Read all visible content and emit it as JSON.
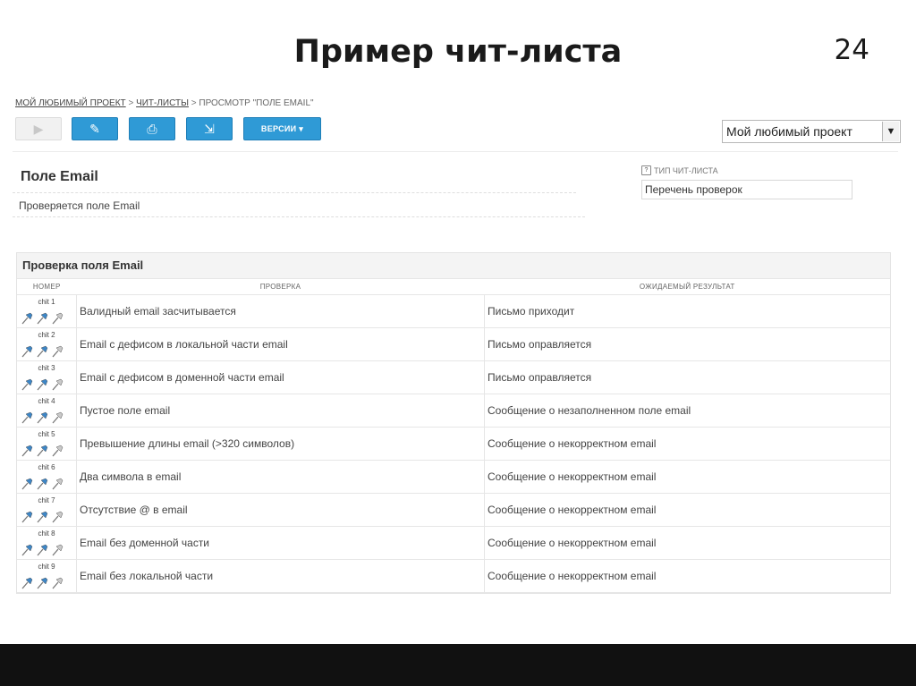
{
  "slide": {
    "title": "Пример чит-листа",
    "number": "24"
  },
  "breadcrumb": {
    "project": "МОЙ ЛЮБИМЫЙ ПРОЕКТ",
    "section": "ЧИТ-ЛИСТЫ",
    "current": "ПРОСМОТР \"ПОЛЕ EMAIL\"",
    "separator": ">"
  },
  "toolbar": {
    "buttons": [
      {
        "name": "run-button",
        "icon": "play-icon",
        "glyph": "▶",
        "disabled": true
      },
      {
        "name": "edit-button",
        "icon": "edit-icon",
        "glyph": "✎",
        "disabled": false
      },
      {
        "name": "print-button",
        "icon": "printer-icon",
        "glyph": "⎙",
        "disabled": false
      },
      {
        "name": "export-button",
        "icon": "export-icon",
        "glyph": "⇲",
        "disabled": false
      }
    ],
    "versions_label": "ВЕРСИИ ▾",
    "project_select": {
      "value": "Мой любимый проект",
      "arrow": "▼"
    }
  },
  "field": {
    "title": "Поле Email",
    "description": "Проверяется поле Email"
  },
  "cheatsheet_type": {
    "help_glyph": "?",
    "label": "ТИП ЧИТ-ЛИСТА",
    "value": "Перечень проверок"
  },
  "checks": {
    "title": "Проверка поля Email",
    "columns": [
      "НОМЕР",
      "ПРОВЕРКА",
      "ОЖИДАЕМЫЙ РЕЗУЛЬТАТ"
    ],
    "rows": [
      {
        "num": "chit 1",
        "check": "Валидный email засчитывается",
        "expected": "Письмо приходит",
        "pins": [
          true,
          true,
          false
        ]
      },
      {
        "num": "chit 2",
        "check": "Email с дефисом в локальной части email",
        "expected": "Письмо оправляется",
        "pins": [
          true,
          true,
          false
        ]
      },
      {
        "num": "chit 3",
        "check": "Email с дефисом в доменной части email",
        "expected": "Письмо оправляется",
        "pins": [
          true,
          true,
          false
        ]
      },
      {
        "num": "chit 4",
        "check": "Пустое поле email",
        "expected": "Сообщение о незаполненном поле email",
        "pins": [
          true,
          true,
          false
        ]
      },
      {
        "num": "chit 5",
        "check": "Превышение длины email (>320 символов)",
        "expected": "Сообщение о некорректном email",
        "pins": [
          true,
          true,
          false
        ]
      },
      {
        "num": "chit 6",
        "check": "Два символа в email",
        "expected": "Сообщение о некорректном email",
        "pins": [
          true,
          true,
          false
        ]
      },
      {
        "num": "chit 7",
        "check": "Отсутствие @ в email",
        "expected": "Сообщение о некорректном email",
        "pins": [
          true,
          true,
          false
        ]
      },
      {
        "num": "chit 8",
        "check": "Email без доменной части",
        "expected": "Сообщение о некорректном email",
        "pins": [
          true,
          true,
          false
        ]
      },
      {
        "num": "chit 9",
        "check": "Email без локальной части",
        "expected": "Сообщение о некорректном email",
        "pins": [
          true,
          true,
          false
        ]
      }
    ]
  },
  "colors": {
    "accent": "#2f9ad6",
    "pin_active": "#3d86c6",
    "pin_inactive": "#c9c9c9",
    "footer": "#111111"
  }
}
